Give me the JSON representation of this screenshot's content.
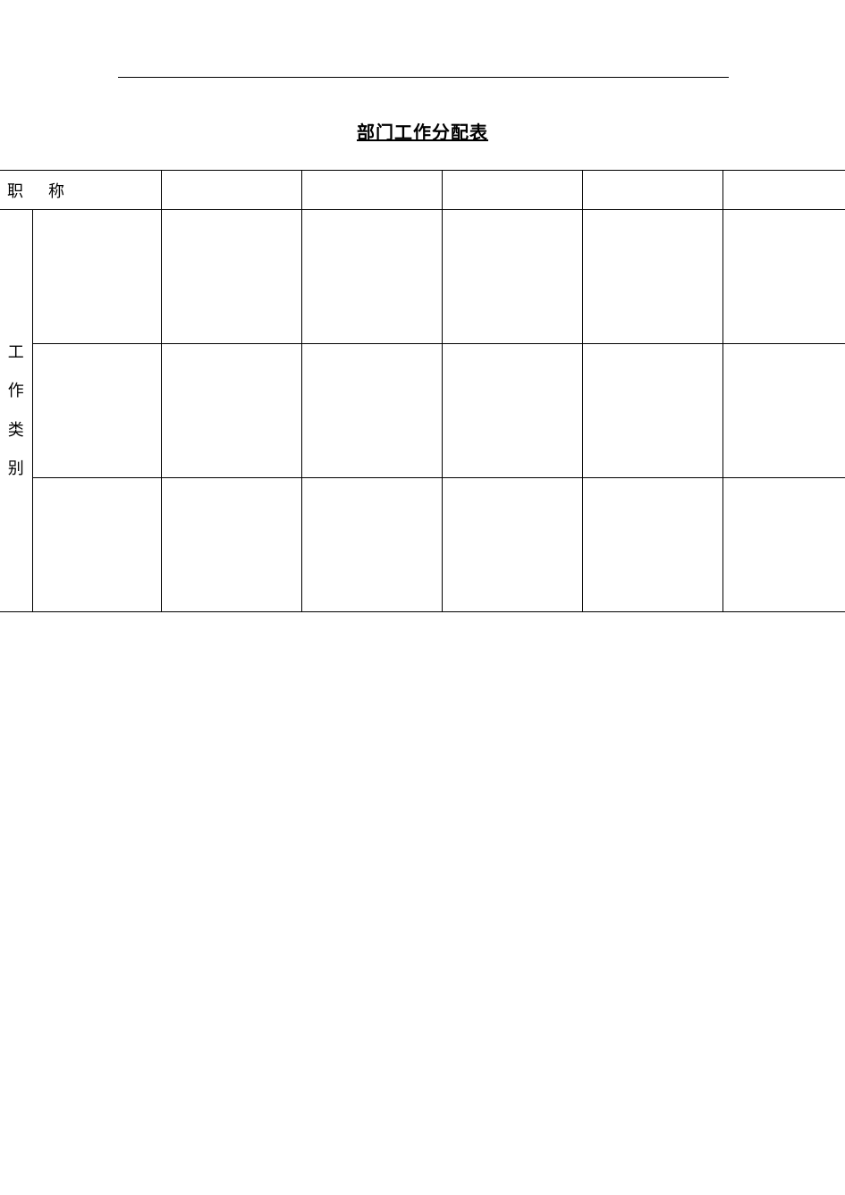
{
  "title": "部门工作分配表",
  "header": {
    "row_label": "职称"
  },
  "side_label": {
    "c1": "工",
    "c2": "作",
    "c3": "类",
    "c4": "别"
  },
  "columns": [
    "",
    "",
    "",
    "",
    ""
  ],
  "rows": [
    {
      "category": "",
      "cells": [
        "",
        "",
        "",
        "",
        ""
      ]
    },
    {
      "category": "",
      "cells": [
        "",
        "",
        "",
        "",
        ""
      ]
    },
    {
      "category": "",
      "cells": [
        "",
        "",
        "",
        "",
        ""
      ]
    }
  ]
}
